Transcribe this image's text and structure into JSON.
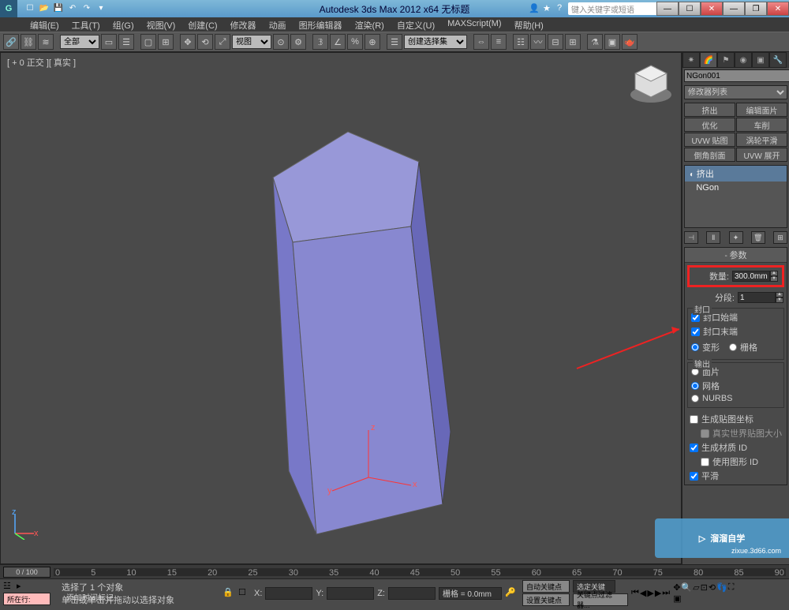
{
  "app": {
    "title": "Autodesk 3ds Max 2012 x64   无标题",
    "search_placeholder": "键入关键字或短语"
  },
  "menus": [
    "编辑(E)",
    "工具(T)",
    "组(G)",
    "视图(V)",
    "创建(C)",
    "修改器",
    "动画",
    "图形编辑器",
    "渲染(R)",
    "自定义(U)",
    "MAXScript(M)",
    "帮助(H)"
  ],
  "toolbar": {
    "scope": "全部",
    "view": "视图",
    "selset": "创建选择集"
  },
  "viewport": {
    "label": "[ + 0 正交 ][ 真实 ]"
  },
  "panel": {
    "object_name": "NGon001",
    "modlist_label": "修改器列表",
    "buttons": [
      "挤出",
      "编辑面片",
      "优化",
      "车削",
      "UVW 贴图",
      "涡轮平滑",
      "倒角剖面",
      "UVW 展开"
    ],
    "stack": {
      "item1": "挤出",
      "item2": "NGon"
    },
    "rollout_title": "参数",
    "amount_label": "数量:",
    "amount_value": "300.0mm",
    "segs_label": "分段:",
    "segs_value": "1",
    "cap_group": "封口",
    "cap_start": "封口始端",
    "cap_end": "封口末端",
    "cap_morph": "变形",
    "cap_grid": "栅格",
    "out_group": "输出",
    "out_patch": "面片",
    "out_mesh": "网格",
    "out_nurbs": "NURBS",
    "gen_map": "生成贴图坐标",
    "real_world": "真实世界贴图大小",
    "gen_mat": "生成材质 ID",
    "use_shape": "使用图形 ID",
    "smooth": "平滑"
  },
  "timeline": {
    "pos": "0 / 100",
    "ticks": [
      "0",
      "5",
      "10",
      "15",
      "20",
      "25",
      "30",
      "35",
      "40",
      "45",
      "50",
      "55",
      "60",
      "65",
      "70",
      "75",
      "80",
      "85",
      "90"
    ]
  },
  "status": {
    "goto_label": "所在行:",
    "sel": "选择了 1 个对象",
    "hint": "单击或单击并拖动以选择对象",
    "add_key": "添加时间标记",
    "grid": "栅格 = 0.0mm",
    "autokey": "自动关键点",
    "setkey": "设置关键点",
    "filter": "关键点过滤器...",
    "selkey": "选定关键"
  },
  "watermark": {
    "text": "溜溜自学",
    "sub": "zixue.3d66.com"
  }
}
